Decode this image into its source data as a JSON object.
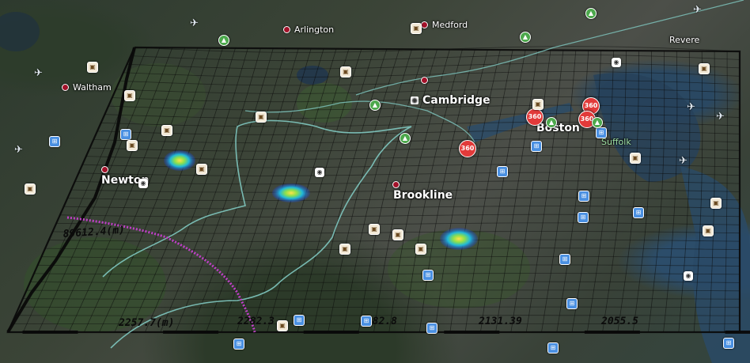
{
  "places": {
    "arlington": "Arlington",
    "medford": "Medford",
    "waltham": "Waltham",
    "cambridge": "Cambridge",
    "boston": "Boston",
    "newton": "Newton",
    "brookline": "Brookline",
    "revere": "Revere",
    "suffolk": "Suffolk"
  },
  "grid_labels": {
    "left_axis": "89612.4(m)",
    "bottom_1": "2257.7(m)",
    "bottom_2": "2282.3",
    "bottom_3": "2182.8",
    "bottom_4": "2131.39",
    "bottom_5": "2055.5"
  },
  "pin_label": "360",
  "icons": {
    "transit": "transit-icon",
    "museum": "museum-icon",
    "park": "park-icon",
    "camera": "camera-icon",
    "airport": "airplane-icon"
  },
  "colors": {
    "grid": "#0a0a0a",
    "boundary": "#7fc8c0",
    "track": "#c040c8",
    "hotspot_core": "#ffe14a",
    "hotspot_mid": "#34c46a",
    "hotspot_outer": "#1d3fd8",
    "pin": "#e23a3a"
  }
}
